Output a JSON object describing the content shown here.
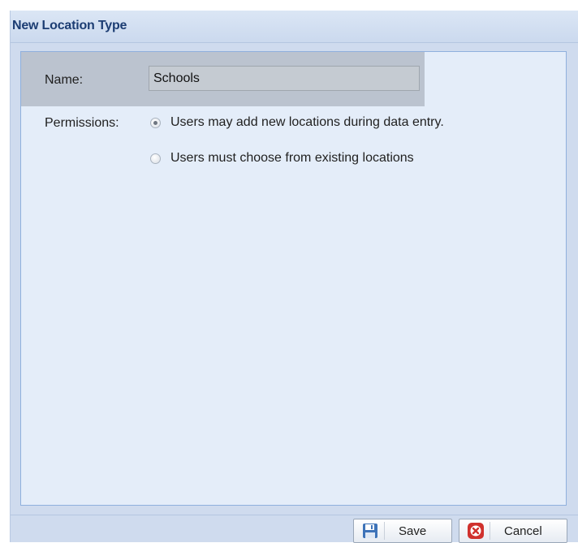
{
  "dialog": {
    "title": "New Location Type",
    "name_label": "Name:",
    "name_value": "Schools",
    "permissions_label": "Permissions:",
    "permission_options": [
      {
        "label": "Users may add new locations during data entry.",
        "checked": true
      },
      {
        "label": "Users must choose from existing locations",
        "checked": false
      }
    ],
    "save_label": "Save",
    "cancel_label": "Cancel"
  },
  "icons": {
    "save": "floppy-disk-icon",
    "cancel": "red-cancel-icon"
  },
  "colors": {
    "title_text": "#1c3d73",
    "panel_background": "#e4edf9",
    "panel_border": "#8fb0dd",
    "dialog_background": "#cfdbee",
    "cancel_icon_red": "#d0312d",
    "save_icon_blue": "#3e73b8"
  }
}
